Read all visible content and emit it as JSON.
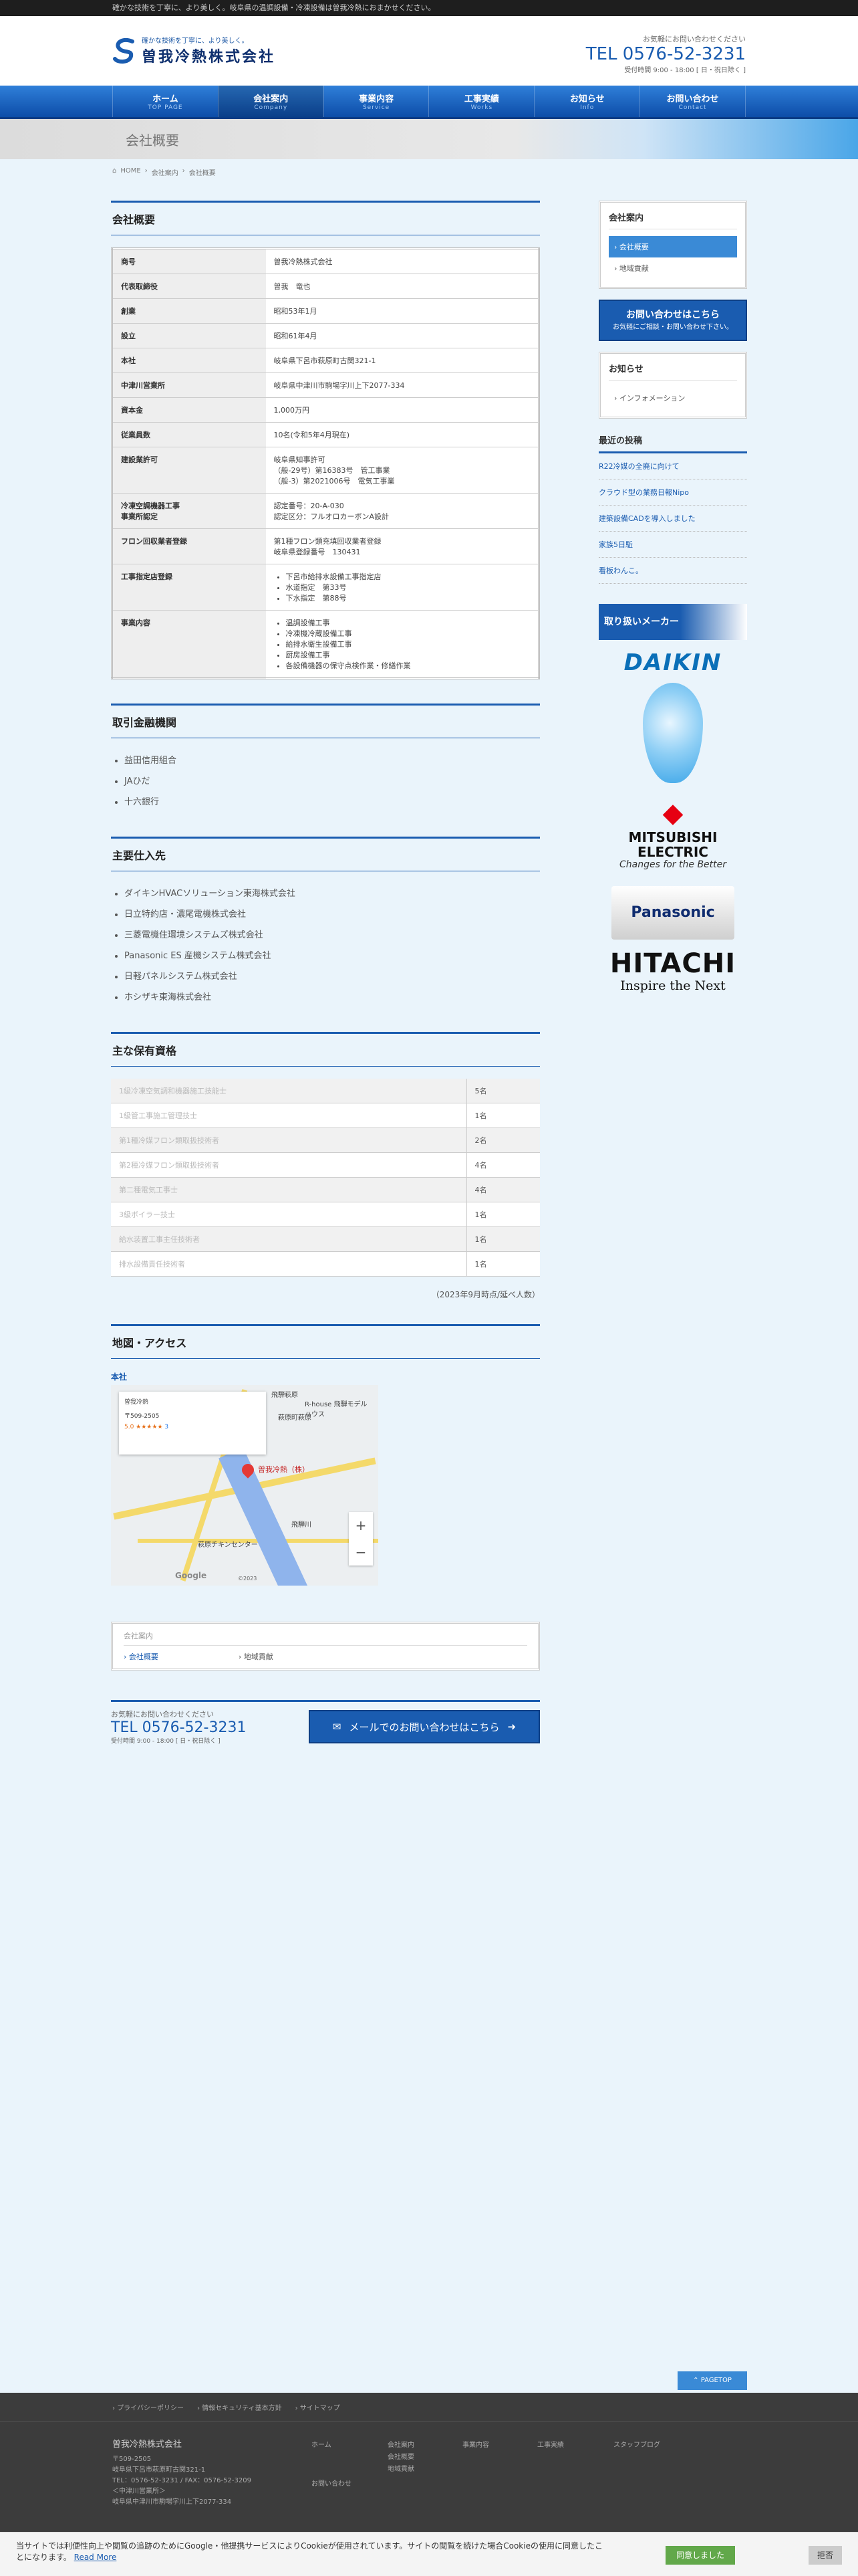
{
  "topbar": {
    "text": "確かな技術を丁寧に、より美しく。岐阜県の温調設備・冷凍設備は曽我冷熱におまかせください。"
  },
  "header": {
    "tagline": "確かな技術を丁寧に、より美しく。",
    "company": "曽我冷熱株式会社",
    "contact_small": "お気軽にお問い合わせください",
    "tel": "TEL 0576-52-3231",
    "hours": "受付時間 9:00 - 18:00 [ 日・祝日除く ]"
  },
  "nav": [
    {
      "jp": "ホーム",
      "en": "TOP PAGE"
    },
    {
      "jp": "会社案内",
      "en": "Company"
    },
    {
      "jp": "事業内容",
      "en": "Service"
    },
    {
      "jp": "工事実績",
      "en": "Works"
    },
    {
      "jp": "お知らせ",
      "en": "Info"
    },
    {
      "jp": "お問い合わせ",
      "en": "Contact"
    }
  ],
  "page_title": "会社概要",
  "breadcrumb": {
    "home": "HOME",
    "parent": "会社案内",
    "current": "会社概要",
    "sep": "›"
  },
  "overview": {
    "heading": "会社概要",
    "rows": [
      {
        "k": "商号",
        "v": "曽我冷熱株式会社"
      },
      {
        "k": "代表取締役",
        "v": "曽我　竜也"
      },
      {
        "k": "創業",
        "v": "昭和53年1月"
      },
      {
        "k": "設立",
        "v": "昭和61年4月"
      },
      {
        "k": "本社",
        "v": "岐阜県下呂市萩原町古関321-1"
      },
      {
        "k": "中津川営業所",
        "v": "岐阜県中津川市駒場字川上下2077-334"
      },
      {
        "k": "資本金",
        "v": "1,000万円"
      },
      {
        "k": "従業員数",
        "v": "10名(令和5年4月現在)"
      },
      {
        "k": "建設業許可",
        "v": "岐阜県知事許可\n（般-29号）第16383号　管工事業\n（般-3）第2021006号　電気工事業"
      },
      {
        "k": "冷凍空調機器工事\n事業所認定",
        "v": "認定番号：20-A-030\n認定区分：フルオロカーボンA設計"
      },
      {
        "k": "フロン回収業者登録",
        "v": "第1種フロン類充填回収業者登録\n岐阜県登録番号　130431"
      },
      {
        "k": "工事指定店登録",
        "list": [
          "下呂市給排水設備工事指定店",
          "水道指定　第33号",
          "下水指定　第88号"
        ]
      },
      {
        "k": "事業内容",
        "list": [
          "温調設備工事",
          "冷凍機冷蔵設備工事",
          "給排水衛生設備工事",
          "厨房設備工事",
          "各設備機器の保守点検作業・修繕作業"
        ]
      }
    ]
  },
  "banks": {
    "heading": "取引金融機関",
    "items": [
      "益田信用組合",
      "JAひだ",
      "十六銀行"
    ]
  },
  "suppliers": {
    "heading": "主要仕入先",
    "items": [
      "ダイキンHVACソリューション東海株式会社",
      "日立特約店・濃尾電機株式会社",
      "三菱電機住環境システムズ株式会社",
      "Panasonic ES 産機システム株式会社",
      "日軽パネルシステム株式会社",
      "ホシザキ東海株式会社"
    ]
  },
  "licenses": {
    "heading": "主な保有資格",
    "rows": [
      {
        "k": "1級冷凍空気調和機器施工技能士",
        "v": "5名"
      },
      {
        "k": "1級管工事施工管理技士",
        "v": "1名"
      },
      {
        "k": "第1種冷媒フロン類取扱技術者",
        "v": "2名"
      },
      {
        "k": "第2種冷媒フロン類取扱技術者",
        "v": "4名"
      },
      {
        "k": "第二種電気工事士",
        "v": "4名"
      },
      {
        "k": "3級ボイラー技士",
        "v": "1名"
      },
      {
        "k": "給水装置工事主任技術者",
        "v": "1名"
      },
      {
        "k": "排水設備責任技術者",
        "v": "1名"
      }
    ],
    "note": "（2023年9月時点/延べ人数）"
  },
  "access": {
    "heading": "地図・アクセス",
    "caption": "本社",
    "map": {
      "card_title": "曽我冷熱",
      "card_addr": "〒509-2505",
      "rating": "5.0 ★★★★★",
      "reviews": "3",
      "pin_label": "曽我冷熱（株）",
      "labels": [
        "飛騨萩原",
        "萩原町萩原",
        "R-house 飛騨モデルハウス",
        "萩原チキンセンター",
        "飛騨川"
      ],
      "google": "Google",
      "copyright": "©2023"
    }
  },
  "subnav": {
    "title": "会社案内",
    "items": [
      "会社概要",
      "地域貢献"
    ]
  },
  "cta": {
    "small": "お気軽にお問い合わせください",
    "tel": "TEL 0576-52-3231",
    "hours": "受付時間 9:00 - 18:00 [ 日・祝日除く ]",
    "mail": "メールでのお問い合わせはこちら"
  },
  "sidebar": {
    "company": {
      "title": "会社案内",
      "items": [
        "会社概要",
        "地域貢献"
      ]
    },
    "contact_btn": {
      "main": "お問い合わせはこちら",
      "sub": "お気軽にご相談・お問い合わせ下さい。"
    },
    "info": {
      "title": "お知らせ",
      "items": [
        "インフォメーション"
      ]
    },
    "recent": {
      "title": "最近の投稿",
      "items": [
        "R22冷媒の全廃に向けて",
        "クラウド型の業務日報Nipo",
        "建築設備CADを導入しました",
        "家族5日駈",
        "看板わんこ。"
      ]
    },
    "maker_banner": "取り扱いメーカー",
    "brands": {
      "daikin": "DAIKIN",
      "mitsubishi1": "MITSUBISHI",
      "mitsubishi2": "ELECTRIC",
      "mitsubishi3": "Changes for the Better",
      "panasonic": "Panasonic",
      "hitachi": "HITACHI",
      "hitachi_sub": "Inspire the Next"
    }
  },
  "pagetop": "PAGETOP",
  "footer": {
    "links": [
      "プライバシーポリシー",
      "情報セキュリティ基本方針",
      "サイトマップ"
    ],
    "company": "曽我冷熱株式会社",
    "addr": [
      "〒509-2505",
      "岐阜県下呂市萩原町古関321-1",
      "TEL：0576-52-3231 / FAX：0576-52-3209",
      "＜中津川営業所＞",
      "岐阜県中津川市駒場字川上下2077-334"
    ],
    "col1": [
      "ホーム",
      "お問い合わせ"
    ],
    "col2": [
      "会社案内",
      "会社概要",
      "地域貢献"
    ],
    "col3": [
      "事業内容"
    ],
    "col4": [
      "工事実績"
    ],
    "col5": [
      "スタッフブログ"
    ]
  },
  "cookie": {
    "text": "当サイトでは利便性向上や閲覧の追跡のためにGoogle・他提携サービスによりCookieが使用されています。サイトの閲覧を続けた場合Cookieの使用に同意したことになります。",
    "more": "Read More",
    "agree": "同意しました",
    "reject": "拒否"
  }
}
